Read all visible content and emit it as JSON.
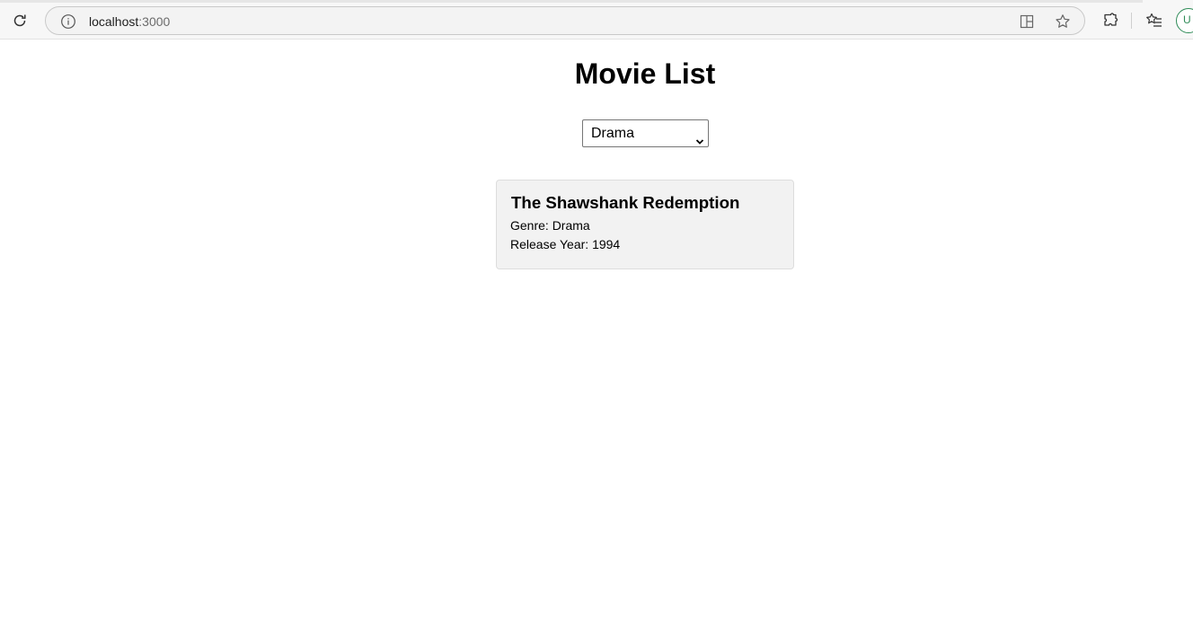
{
  "browser": {
    "url_host": "localhost",
    "url_port": ":3000",
    "profile_initial": "U"
  },
  "page": {
    "title": "Movie List",
    "genre_filter": {
      "selected": "Drama"
    },
    "movies": [
      {
        "title": "The Shawshank Redemption",
        "genre_text": "Genre: Drama",
        "year_text": "Release Year: 1994"
      }
    ]
  },
  "colors": {
    "profile_ring": "#2e8b57",
    "card_background": "#f2f2f2"
  }
}
